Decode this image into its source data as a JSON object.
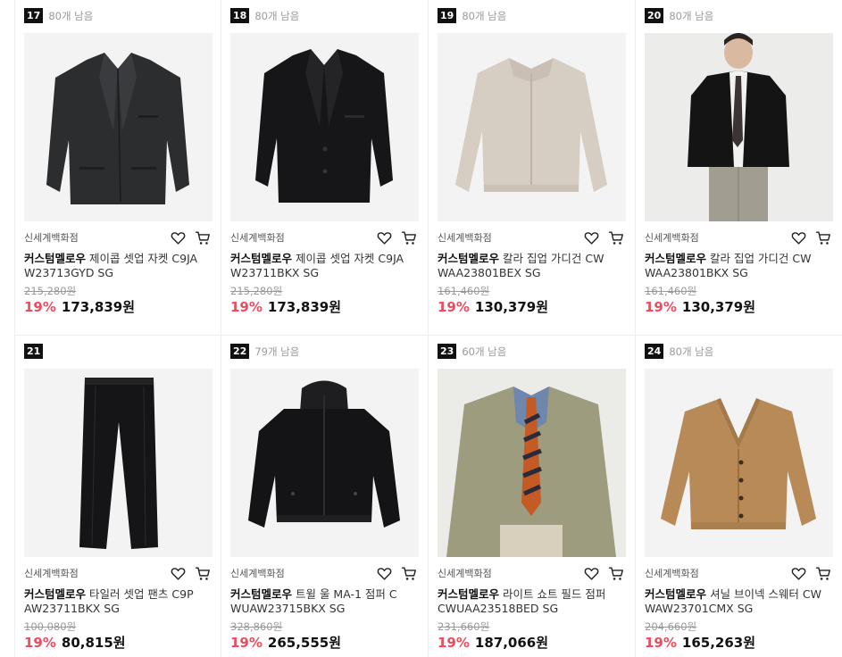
{
  "products": [
    {
      "rank": "17",
      "stock": "80개 남음",
      "shop": "신세계백화점",
      "brand": "커스텀멜로우",
      "title": " 제이콥 셋업 자켓 C9JA W23713GYD SG",
      "original_price": "215,280원",
      "discount": "19%",
      "price": "173,839원",
      "image": "dark-gray-blazer-icon"
    },
    {
      "rank": "18",
      "stock": "80개 남음",
      "shop": "신세계백화점",
      "brand": "커스텀멜로우",
      "title": " 제이콥 셋업 자켓 C9JA W23711BKX SG",
      "original_price": "215,280원",
      "discount": "19%",
      "price": "173,839원",
      "image": "black-blazer-icon"
    },
    {
      "rank": "19",
      "stock": "80개 남음",
      "shop": "신세계백화점",
      "brand": "커스텀멜로우",
      "title": " 칼라 집업 가디건 CW WAA23801BEX SG",
      "original_price": "161,460원",
      "discount": "19%",
      "price": "130,379원",
      "image": "beige-cardigan-icon"
    },
    {
      "rank": "20",
      "stock": "80개 남음",
      "shop": "신세계백화점",
      "brand": "커스텀멜로우",
      "title": " 칼라 집업 가디건 CW WAA23801BKX SG",
      "original_price": "161,460원",
      "discount": "19%",
      "price": "130,379원",
      "image": "model-black-cardigan-icon"
    },
    {
      "rank": "21",
      "stock": "",
      "shop": "신세계백화점",
      "brand": "커스텀멜로우",
      "title": " 타일러 셋업 팬츠 C9P AW23711BKX SG",
      "original_price": "100,080원",
      "discount": "19%",
      "price": "80,815원",
      "image": "black-pants-icon"
    },
    {
      "rank": "22",
      "stock": "79개 남음",
      "shop": "신세계백화점",
      "brand": "커스텀멜로우",
      "title": " 트윌 울 MA-1 점퍼 C WUAW23715BKX SG",
      "original_price": "328,860원",
      "discount": "19%",
      "price": "265,555원",
      "image": "black-jumper-icon"
    },
    {
      "rank": "23",
      "stock": "60개 남음",
      "shop": "신세계백화점",
      "brand": "커스텀멜로우",
      "title": " 라이트 쇼트 필드 점퍼 CWUAA23518BED SG",
      "original_price": "231,660원",
      "discount": "19%",
      "price": "187,066원",
      "image": "model-khaki-jacket-icon"
    },
    {
      "rank": "24",
      "stock": "80개 남음",
      "shop": "신세계백화점",
      "brand": "커스텀멜로우",
      "title": " 셔닐 브이넥 스웨터 CW WAW23701CMX SG",
      "original_price": "204,660원",
      "discount": "19%",
      "price": "165,263원",
      "image": "camel-cardigan-icon"
    }
  ],
  "icons": {
    "wishlist": "heart-icon",
    "cart": "cart-icon"
  },
  "colors": {
    "discount": "#f04a5c",
    "rank_badge": "#111111"
  }
}
